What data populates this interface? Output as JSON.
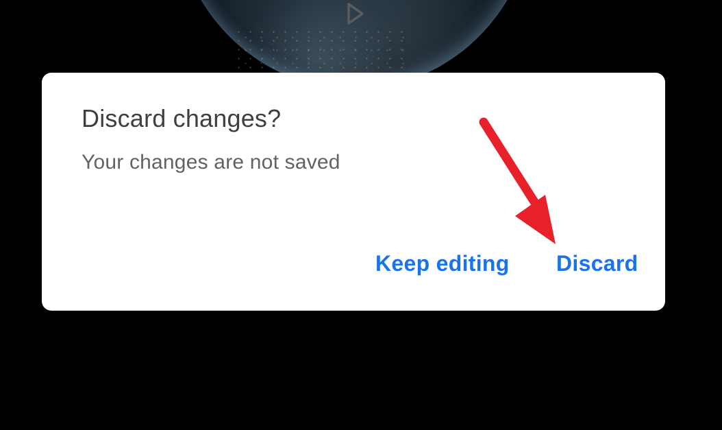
{
  "background": {
    "globe_icon": "earth-globe-image",
    "play_icon": "play-icon"
  },
  "dialog": {
    "title": "Discard changes?",
    "message": "Your changes are not saved",
    "keep_label": "Keep editing",
    "discard_label": "Discard"
  },
  "annotation": {
    "arrow_icon": "red-arrow-icon",
    "color": "#e8202a"
  },
  "colors": {
    "accent": "#1a73e8",
    "title_text": "#3c4043",
    "body_text": "#5f6368",
    "backdrop": "#000000",
    "dialog_bg": "#ffffff"
  }
}
